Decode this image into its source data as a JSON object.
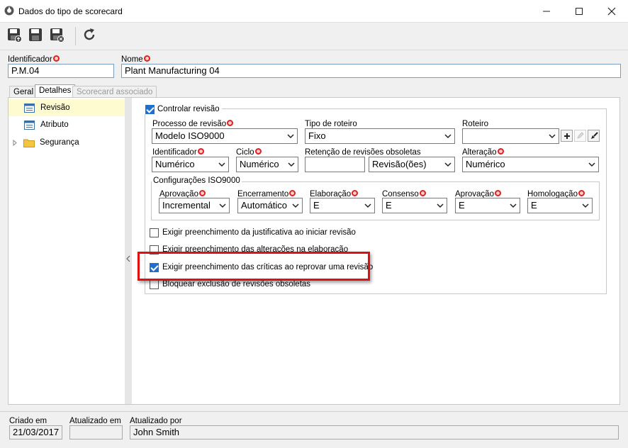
{
  "window": {
    "title": "Dados do tipo de scorecard"
  },
  "toolbar": {
    "save": "save-icon",
    "save_new": "save-new-icon",
    "save_close": "save-close-icon",
    "refresh": "refresh-icon"
  },
  "header": {
    "identificador_label": "Identificador",
    "identificador_value": "P.M.04",
    "nome_label": "Nome",
    "nome_value": "Plant Manufacturing 04"
  },
  "tabs": [
    {
      "label": "Geral"
    },
    {
      "label": "Detalhes"
    },
    {
      "label": "Scorecard associado"
    }
  ],
  "tree": [
    {
      "label": "Revisão"
    },
    {
      "label": "Atributo"
    },
    {
      "label": "Segurança"
    }
  ],
  "revision": {
    "controlar_label": "Controlar revisão",
    "controlar_checked": true,
    "processo_label": "Processo de revisão",
    "processo_value": "Modelo ISO9000",
    "tipo_roteiro_label": "Tipo de roteiro",
    "tipo_roteiro_value": "Fixo",
    "roteiro_label": "Roteiro",
    "roteiro_value": "",
    "identificador_label": "Identificador",
    "identificador_value": "Numérico",
    "ciclo_label": "Ciclo",
    "ciclo_value": "Numérico",
    "retencao_label": "Retenção de revisões obsoletas",
    "retencao_value": "",
    "retencao_unit": "Revisão(ões)",
    "alteracao_label": "Alteração",
    "alteracao_value": "Numérico"
  },
  "iso": {
    "group_label": "Configurações ISO9000",
    "aprovacao_label": "Aprovação",
    "aprovacao_value": "Incremental",
    "encerramento_label": "Encerramento",
    "encerramento_value": "Automático",
    "elaboracao_label": "Elaboração",
    "elaboracao_value": "E",
    "consenso_label": "Consenso",
    "consenso_value": "E",
    "aprovacao2_label": "Aprovação",
    "aprovacao2_value": "E",
    "homologacao_label": "Homologação",
    "homologacao_value": "E"
  },
  "options": [
    {
      "label": "Exigir preenchimento da justificativa ao iniciar revisão",
      "checked": false
    },
    {
      "label": "Exigir preenchimento das alterações na elaboração",
      "checked": false
    },
    {
      "label": "Exigir preenchimento das críticas ao reprovar uma revisão",
      "checked": true
    },
    {
      "label": "Bloquear exclusão de revisões obsoletas",
      "checked": false
    }
  ],
  "footer": {
    "criado_label": "Criado em",
    "criado_value": "21/03/2017",
    "atualizado_em_label": "Atualizado em",
    "atualizado_em_value": "",
    "atualizado_por_label": "Atualizado por",
    "atualizado_por_value": "John Smith"
  }
}
